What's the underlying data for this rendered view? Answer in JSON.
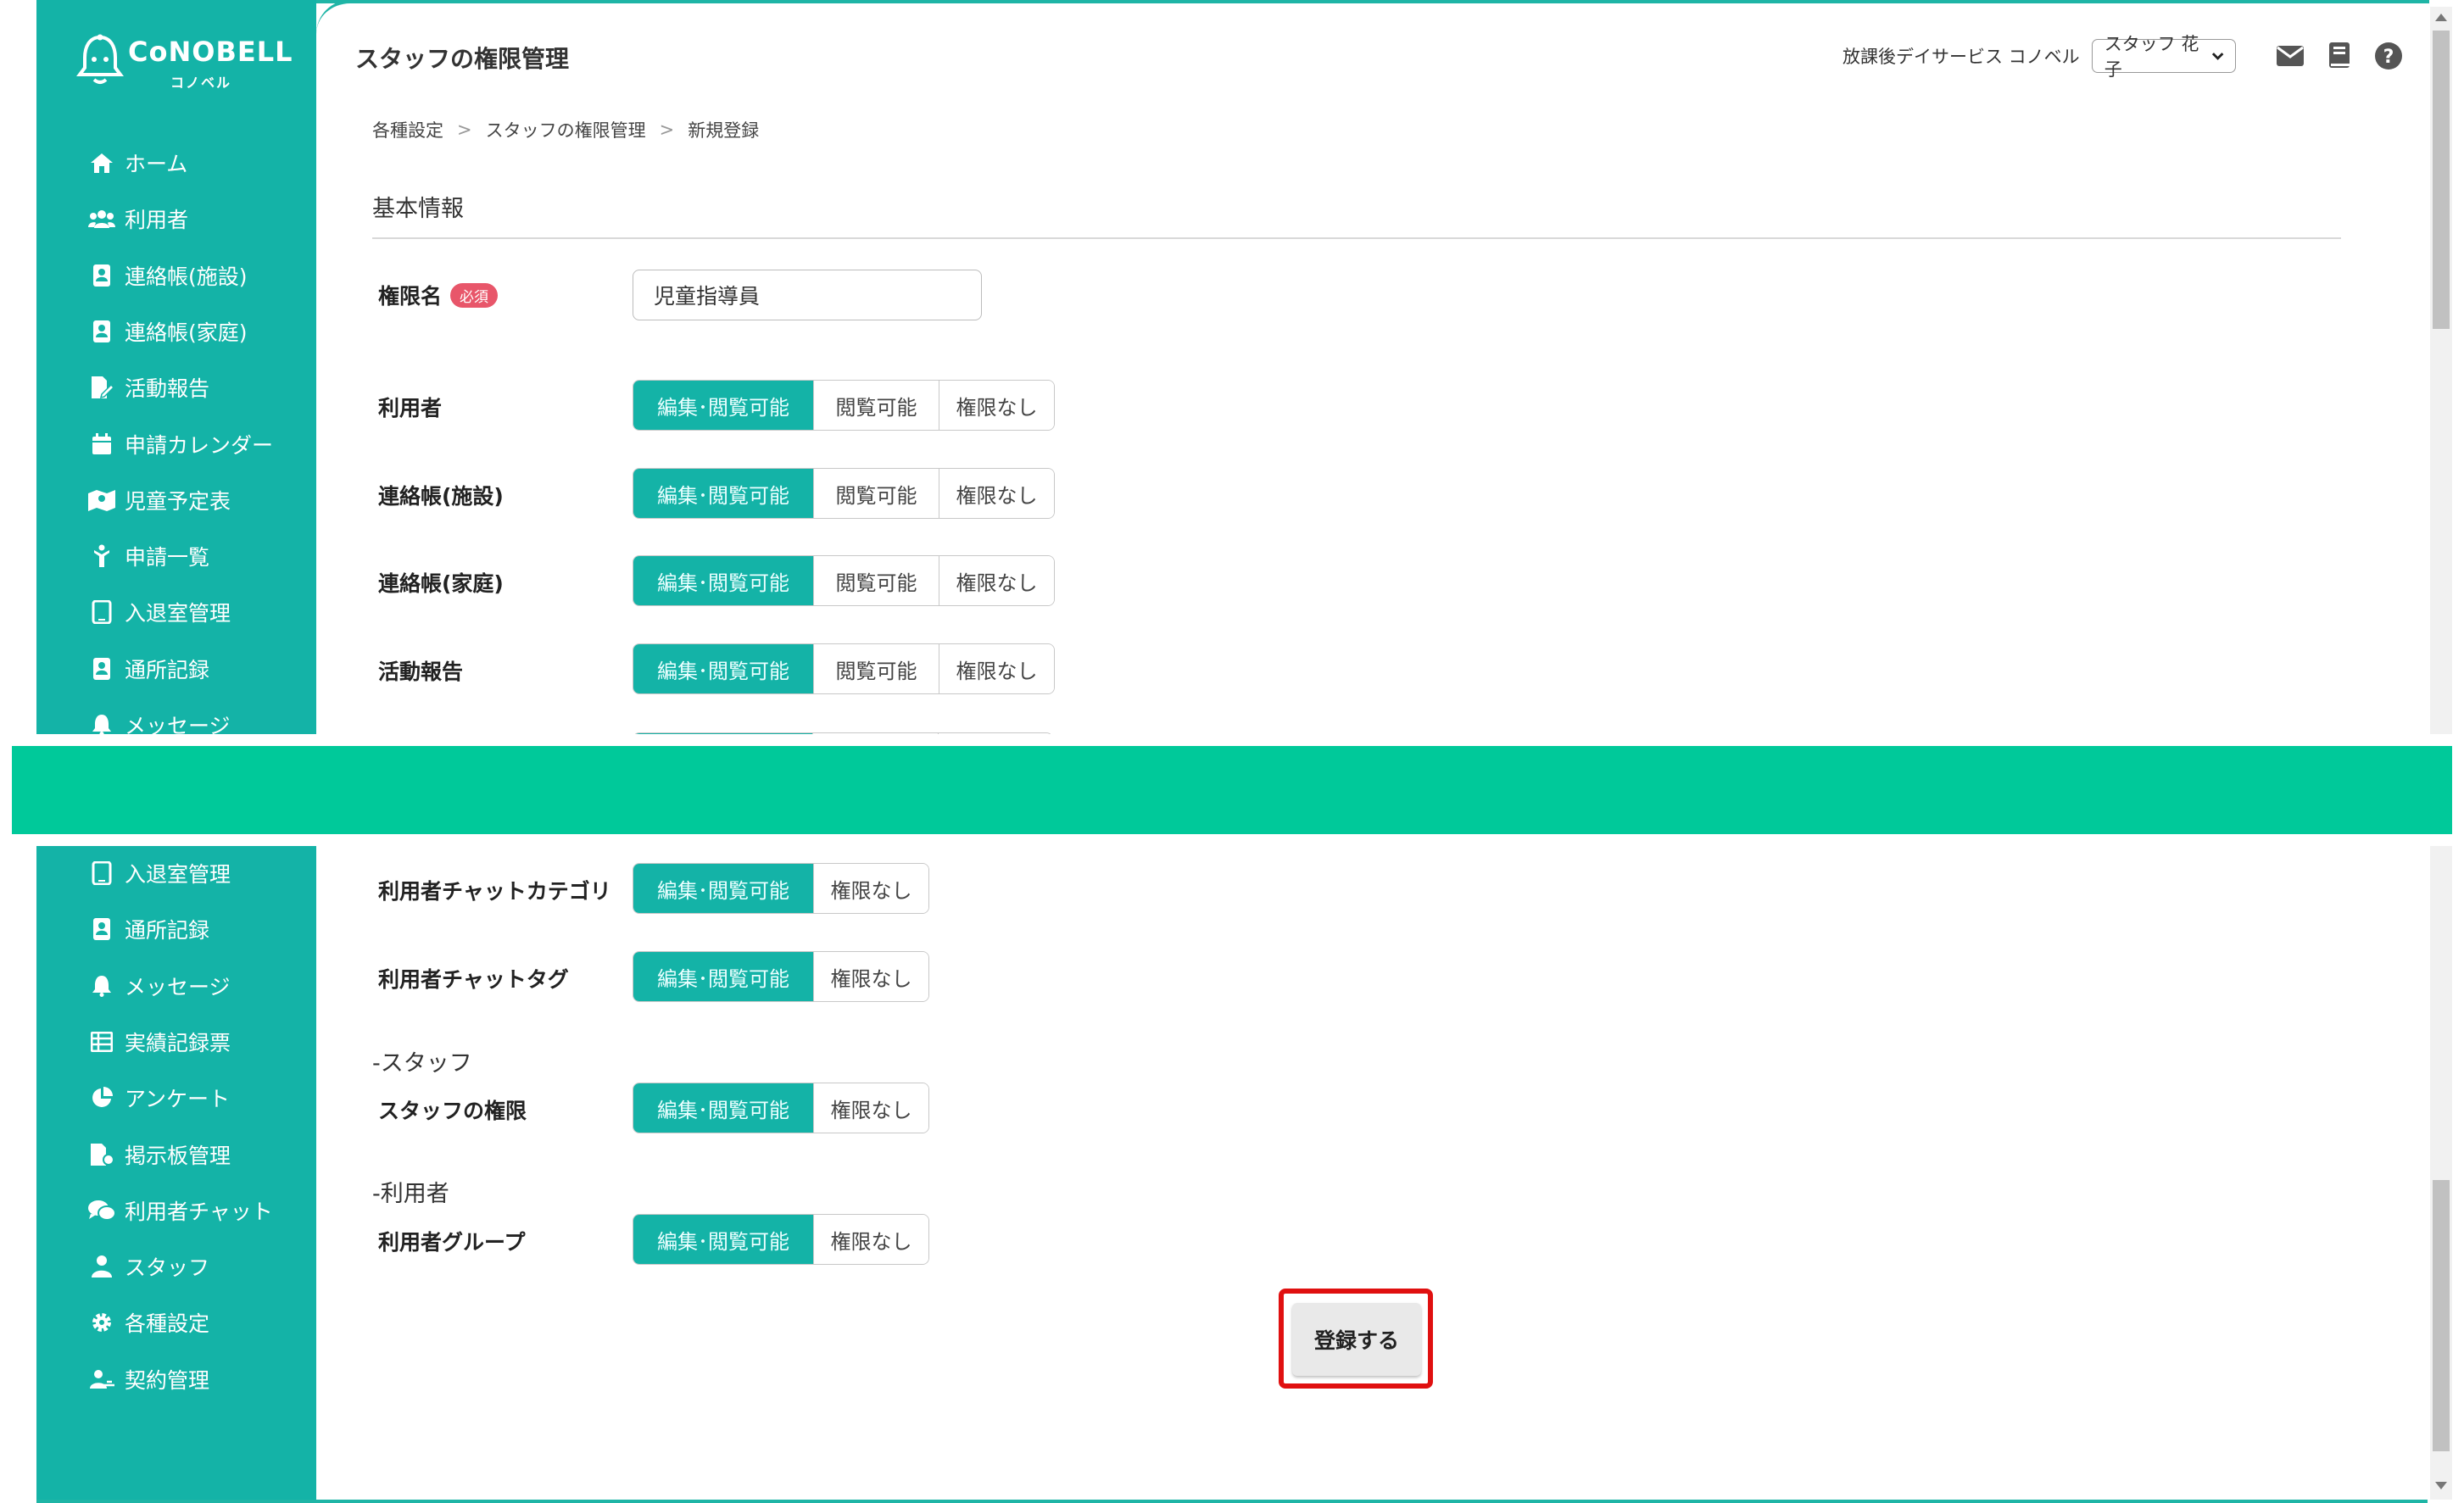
{
  "app": {
    "logo_name": "CoNOBELL",
    "logo_sub": "コノベル",
    "page_title": "スタッフの権限管理",
    "facility_name": "放課後デイサービス コノベル",
    "user_name": "スタッフ 花子"
  },
  "icons": {
    "header": [
      "mail-icon",
      "book-icon",
      "help-icon"
    ],
    "accent_color": "#14b3a7",
    "band_color": "#00c99a",
    "highlight_color": "#e01010"
  },
  "breadcrumb": [
    "各種設定",
    "スタッフの権限管理",
    "新規登録"
  ],
  "section": {
    "basic_info": "基本情報",
    "staff_group": "-スタッフ",
    "user_group": "-利用者"
  },
  "form": {
    "role_name_label": "権限名",
    "required_badge": "必須",
    "role_name_value": "児童指導員"
  },
  "options": {
    "edit_view": "編集･閲覧可能",
    "view_only": "閲覧可能",
    "none": "権限なし"
  },
  "permission_rows_top": [
    {
      "label": "利用者"
    },
    {
      "label": "連絡帳(施設)"
    },
    {
      "label": "連絡帳(家庭)"
    },
    {
      "label": "活動報告"
    }
  ],
  "permission_rows_bottom": [
    {
      "label": "利用者チャットカテゴリ"
    },
    {
      "label": "利用者チャットタグ"
    },
    {
      "label": "スタッフの権限"
    },
    {
      "label": "利用者グループ"
    }
  ],
  "sidebar_top": [
    {
      "label": "ホーム",
      "icon": "home-icon"
    },
    {
      "label": "利用者",
      "icon": "users-icon"
    },
    {
      "label": "連絡帳(施設)",
      "icon": "contact-book-icon"
    },
    {
      "label": "連絡帳(家庭)",
      "icon": "contact-book-icon"
    },
    {
      "label": "活動報告",
      "icon": "report-edit-icon"
    },
    {
      "label": "申請カレンダー",
      "icon": "calendar-icon"
    },
    {
      "label": "児童予定表",
      "icon": "map-icon"
    },
    {
      "label": "申請一覧",
      "icon": "child-icon"
    },
    {
      "label": "入退室管理",
      "icon": "tablet-icon"
    },
    {
      "label": "通所記録",
      "icon": "contact-book-icon"
    },
    {
      "label": "メッセージ",
      "icon": "bell-icon"
    }
  ],
  "sidebar_bottom": [
    {
      "label": "入退室管理",
      "icon": "tablet-icon"
    },
    {
      "label": "通所記録",
      "icon": "contact-book-icon"
    },
    {
      "label": "メッセージ",
      "icon": "bell-icon"
    },
    {
      "label": "実績記録票",
      "icon": "table-icon"
    },
    {
      "label": "アンケート",
      "icon": "pie-chart-icon"
    },
    {
      "label": "掲示板管理",
      "icon": "bulletin-icon"
    },
    {
      "label": "利用者チャット",
      "icon": "chat-icon"
    },
    {
      "label": "スタッフ",
      "icon": "staff-icon"
    },
    {
      "label": "各種設定",
      "icon": "gear-icon"
    },
    {
      "label": "契約管理",
      "icon": "contract-icon"
    }
  ],
  "submit_label": "登録する"
}
